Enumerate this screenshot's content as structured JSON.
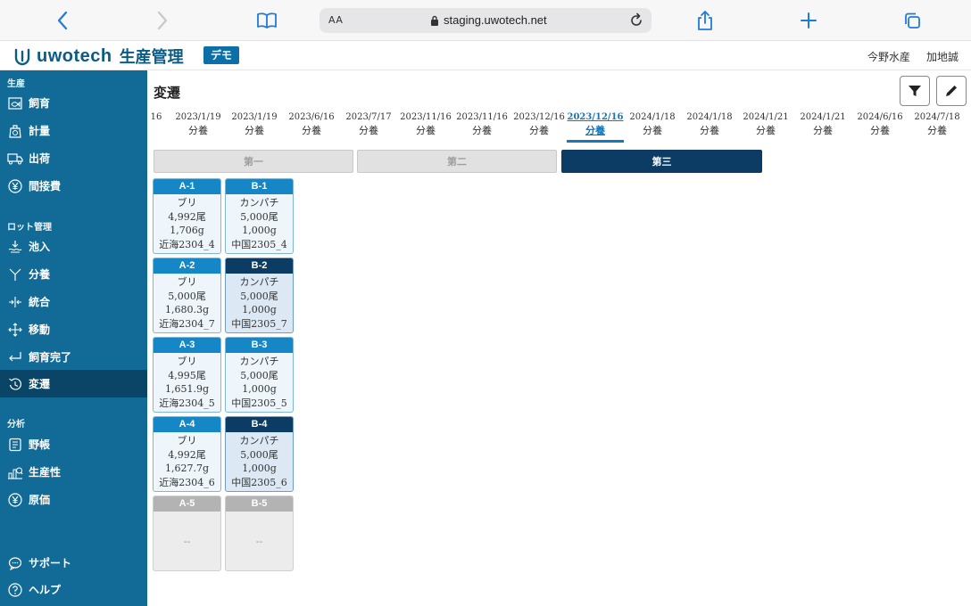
{
  "browser": {
    "aa_label": "AA",
    "url": "staging.uwotech.net"
  },
  "header": {
    "logo_text": "uwotech",
    "logo_sub": "生産管理",
    "demo_badge": "デモ",
    "company": "今野水産",
    "user": "加地誠"
  },
  "sidebar": {
    "sections": [
      "生産",
      "ロット管理",
      "分析"
    ],
    "items": [
      {
        "label": "飼育",
        "icon": "fish-tank-icon"
      },
      {
        "label": "計量",
        "icon": "scale-icon"
      },
      {
        "label": "出荷",
        "icon": "truck-icon"
      },
      {
        "label": "間接費",
        "icon": "yen-circle-icon"
      },
      {
        "label": "池入",
        "icon": "pond-entry-icon"
      },
      {
        "label": "分養",
        "icon": "split-icon"
      },
      {
        "label": "統合",
        "icon": "merge-icon"
      },
      {
        "label": "移動",
        "icon": "move-arrows-icon"
      },
      {
        "label": "飼育完了",
        "icon": "return-icon"
      },
      {
        "label": "変遷",
        "icon": "history-icon"
      },
      {
        "label": "野帳",
        "icon": "notebook-icon"
      },
      {
        "label": "生産性",
        "icon": "productivity-icon"
      },
      {
        "label": "原価",
        "icon": "yen-circle-icon"
      },
      {
        "label": "サポート",
        "icon": "chat-support-icon"
      },
      {
        "label": "ヘルプ",
        "icon": "help-circle-icon"
      }
    ],
    "active": "変遷"
  },
  "main": {
    "title": "変遷",
    "timeline": [
      {
        "date": "16",
        "label": ""
      },
      {
        "date": "2023/1/19",
        "label": "分養"
      },
      {
        "date": "2023/1/19",
        "label": "分養"
      },
      {
        "date": "2023/6/16",
        "label": "分養"
      },
      {
        "date": "2023/7/17",
        "label": "分養"
      },
      {
        "date": "2023/11/16",
        "label": "分養"
      },
      {
        "date": "2023/11/16",
        "label": "分養"
      },
      {
        "date": "2023/12/16",
        "label": "分養"
      },
      {
        "date": "2023/12/16",
        "label": "分養",
        "active": true
      },
      {
        "date": "2024/1/18",
        "label": "分養"
      },
      {
        "date": "2024/1/18",
        "label": "分養"
      },
      {
        "date": "2024/1/21",
        "label": "分養"
      },
      {
        "date": "2024/1/21",
        "label": "分養"
      },
      {
        "date": "2024/6/16",
        "label": "分養"
      },
      {
        "date": "2024/7/18",
        "label": "分養"
      }
    ],
    "segments": [
      "第一",
      "第二",
      "第三"
    ],
    "active_segment": "第三",
    "pens": [
      {
        "name": "A-1",
        "fish": "ブリ",
        "count": "4,992尾",
        "weight": "1,706g",
        "lot": "近海2304_4",
        "style": "light"
      },
      {
        "name": "B-1",
        "fish": "カンパチ",
        "count": "5,000尾",
        "weight": "1,000g",
        "lot": "中国2305_4",
        "style": "light"
      },
      {
        "name": "A-2",
        "fish": "ブリ",
        "count": "5,000尾",
        "weight": "1,680.3g",
        "lot": "近海2304_7",
        "style": "light"
      },
      {
        "name": "B-2",
        "fish": "カンパチ",
        "count": "5,000尾",
        "weight": "1,000g",
        "lot": "中国2305_7",
        "style": "dark"
      },
      {
        "name": "A-3",
        "fish": "ブリ",
        "count": "4,995尾",
        "weight": "1,651.9g",
        "lot": "近海2304_5",
        "style": "light"
      },
      {
        "name": "B-3",
        "fish": "カンパチ",
        "count": "5,000尾",
        "weight": "1,000g",
        "lot": "中国2305_5",
        "style": "light"
      },
      {
        "name": "A-4",
        "fish": "ブリ",
        "count": "4,992尾",
        "weight": "1,627.7g",
        "lot": "近海2304_6",
        "style": "light"
      },
      {
        "name": "B-4",
        "fish": "カンパチ",
        "count": "5,000尾",
        "weight": "1,000g",
        "lot": "中国2305_6",
        "style": "dark"
      },
      {
        "name": "A-5",
        "empty": "--",
        "style": "empty"
      },
      {
        "name": "B-5",
        "empty": "--",
        "style": "empty"
      }
    ]
  },
  "colors": {
    "sidebar_bg": "#116b96",
    "sidebar_active": "#0a4466",
    "pen_header": "#1587c7",
    "pen_header_dark": "#0c3c63",
    "accent": "#1578b8"
  }
}
